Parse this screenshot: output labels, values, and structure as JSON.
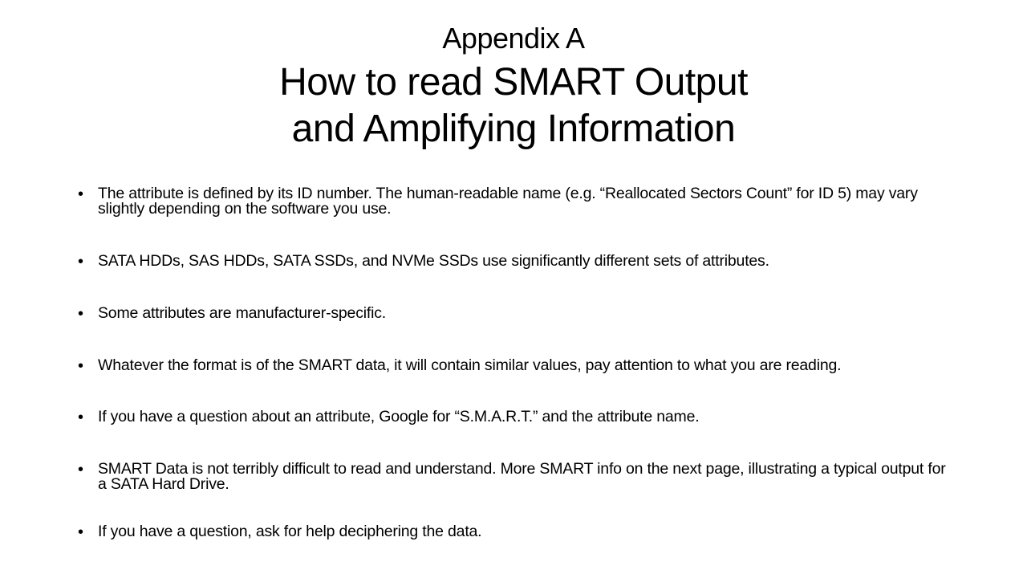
{
  "header": {
    "appendix": "Appendix A",
    "title_line1": "How to read SMART Output",
    "title_line2": "and Amplifying Information"
  },
  "bullets": [
    {
      "marker": "•",
      "text": "The attribute is defined by its ID number. The human-readable name (e.g. “Reallocated Sectors Count” for ID 5) may vary slightly depending on the software you use."
    },
    {
      "marker": "•",
      "text": "SATA HDDs, SAS HDDs, SATA SSDs, and NVMe SSDs use significantly different sets of attributes."
    },
    {
      "marker": "•",
      "text": "Some attributes are manufacturer-specific."
    },
    {
      "marker": "•",
      "text": "Whatever the format is of the SMART data, it will contain similar values, pay attention to what you are reading."
    },
    {
      "marker": "•",
      "text": "If you have a question about an attribute, Google for “S.M.A.R.T.” and the attribute name."
    },
    {
      "marker": "•",
      "text": "SMART Data is not terribly difficult to read and understand. More SMART info on the next page, illustrating a typical output for a SATA Hard Drive."
    },
    {
      "marker": "•",
      "text": "If you have a question, ask for help deciphering the data."
    }
  ]
}
